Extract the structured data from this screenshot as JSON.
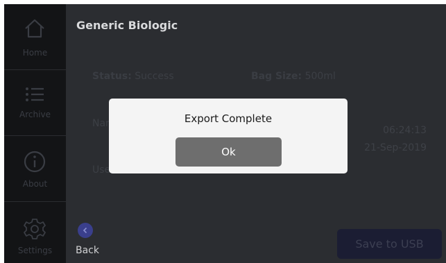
{
  "sidebar": {
    "items": [
      {
        "label": "Home",
        "icon": "home-icon"
      },
      {
        "label": "Archive",
        "icon": "list-icon"
      },
      {
        "label": "About",
        "icon": "info-icon"
      },
      {
        "label": "Settings",
        "icon": "gear-icon"
      }
    ]
  },
  "main": {
    "title": "Generic Biologic",
    "status_label": "Status:",
    "status_value": "Success",
    "bag_size_label": "Bag Size:",
    "bag_size_value": "500ml",
    "name_label_partial": "Nar",
    "user_label_partial": "Use",
    "time": "06:24:13",
    "date": "21-Sep-2019",
    "back_label": "Back",
    "save_label": "Save to USB"
  },
  "dialog": {
    "title": "Export Complete",
    "ok_label": "Ok"
  },
  "colors": {
    "background": "#2b2d31",
    "sidebar": "#131416",
    "accent": "#3a3f8c",
    "dialog": "#f4f4f4",
    "ok_button": "#6e6e6e"
  }
}
